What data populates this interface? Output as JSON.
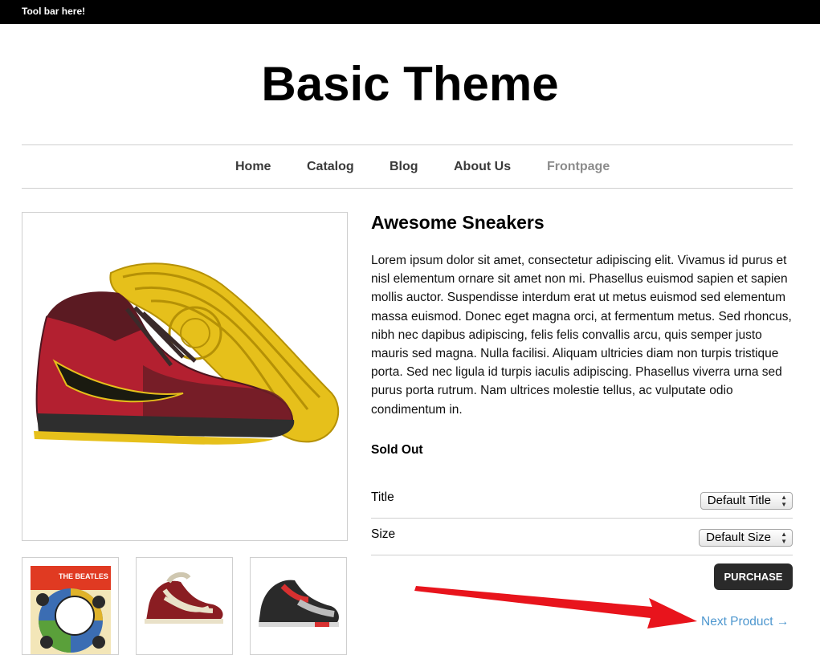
{
  "toolbar": {
    "text": "Tool bar here!"
  },
  "site": {
    "title": "Basic Theme"
  },
  "nav": {
    "items": [
      "Home",
      "Catalog",
      "Blog",
      "About Us",
      "Frontpage"
    ],
    "active": "Frontpage"
  },
  "product": {
    "title": "Awesome Sneakers",
    "description": " Lorem ipsum dolor sit amet, consectetur adipiscing elit. Vivamus id purus et nisl elementum ornare sit amet non mi. Phasellus euismod sapien et sapien mollis auctor. Suspendisse interdum erat ut metus euismod sed elementum massa euismod. Donec eget magna orci, at fermentum metus. Sed rhoncus, nibh nec dapibus adipiscing, felis felis convallis arcu, quis semper justo mauris sed magna. Nulla facilisi. Aliquam ultricies diam non turpis tristique porta. Sed nec ligula id turpis iaculis adipiscing. Phasellus viverra urna sed purus porta rutrum. Nam ultrices molestie tellus, ac vulputate odio condimentum in.",
    "status": "Sold Out",
    "options": [
      {
        "label": "Title",
        "selected": "Default Title"
      },
      {
        "label": "Size",
        "selected": "Default Size"
      }
    ],
    "purchase_label": "PURCHASE",
    "next_label": "Next Product →"
  },
  "thumbnails": [
    {
      "icon": "record-album-image",
      "album_text": "THE BEATLES"
    },
    {
      "icon": "sneaker-red-white-image"
    },
    {
      "icon": "sneaker-black-red-image"
    }
  ],
  "annotation": {
    "color": "#e8141c"
  },
  "colors": {
    "link": "#4e97cf",
    "button": "#2a2a2a",
    "nav_active": "#8c8c8c"
  }
}
